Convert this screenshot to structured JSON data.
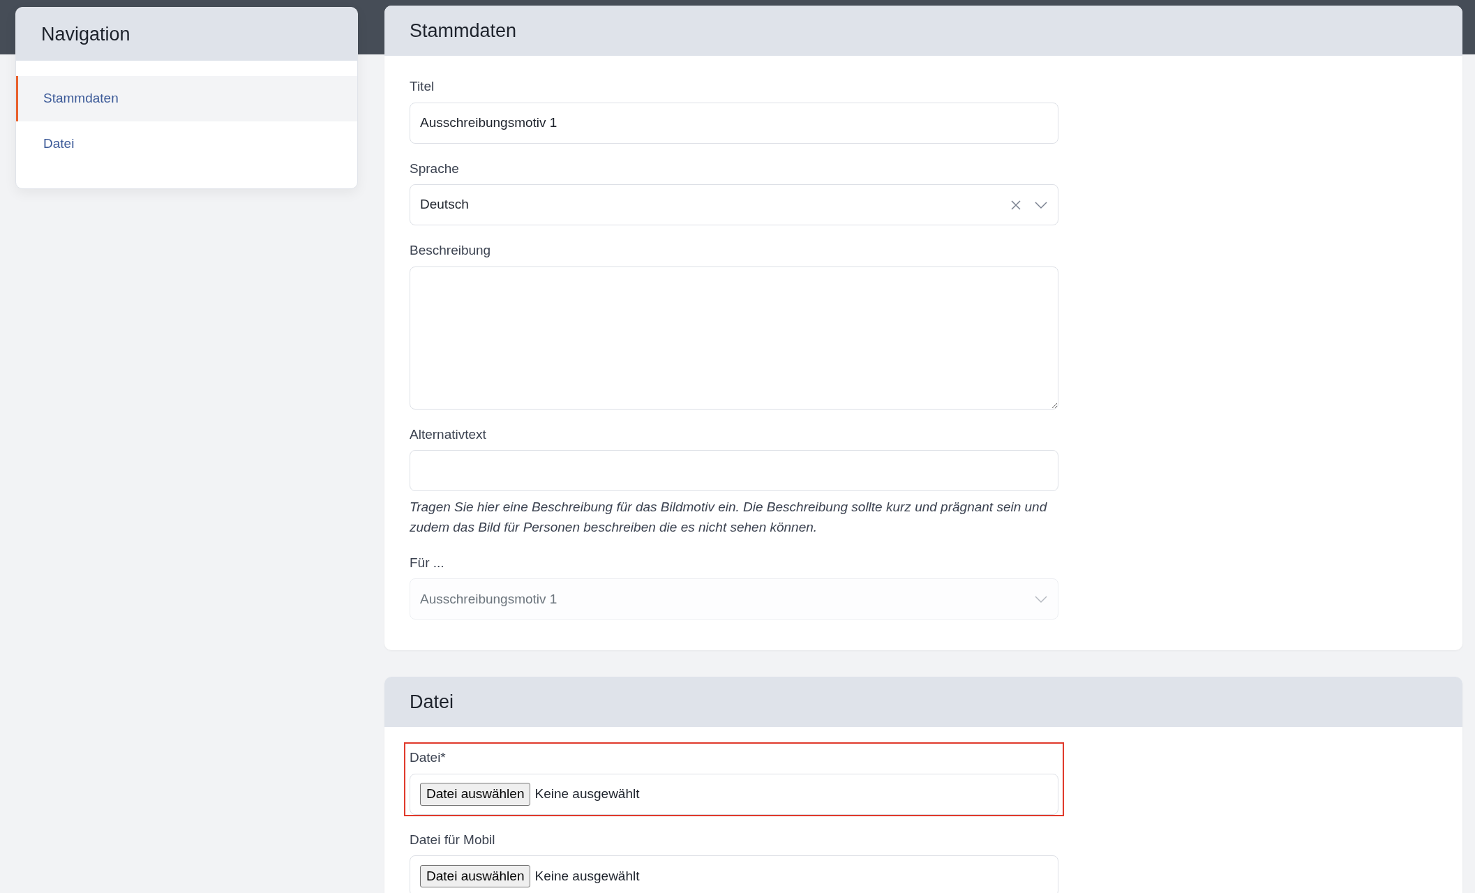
{
  "navigation": {
    "title": "Navigation",
    "items": [
      {
        "label": "Stammdaten",
        "selected": true
      },
      {
        "label": "Datei",
        "selected": false
      }
    ]
  },
  "sections": [
    {
      "title": "Stammdaten",
      "fields": [
        {
          "kind": "text",
          "label": "Titel",
          "value": "Ausschreibungsmotiv 1",
          "disabled": false,
          "highlighted": false
        },
        {
          "kind": "select",
          "label": "Sprache",
          "value": "Deutsch",
          "clearable": true,
          "disabled": false,
          "highlighted": false
        },
        {
          "kind": "textarea",
          "label": "Beschreibung",
          "disabled": false,
          "highlighted": false
        },
        {
          "kind": "text",
          "label": "Alternativtext",
          "help": "Tragen Sie hier eine Beschreibung für das Bildmotiv ein. Die Beschreibung sollte kurz und prägnant sein und zudem das Bild für Personen beschreiben die es nicht sehen können.",
          "disabled": false,
          "highlighted": false
        },
        {
          "kind": "select",
          "label": "Für ...",
          "placeholder": "Ausschreibungsmotiv 1",
          "clearable": false,
          "disabled": true,
          "highlighted": false
        }
      ]
    },
    {
      "title": "Datei",
      "fields": [
        {
          "kind": "file",
          "label": "Datei*",
          "button": "Datei auswählen",
          "status": "Keine ausgewählt",
          "disabled": false,
          "highlighted": true
        },
        {
          "kind": "file",
          "label": "Datei für Mobil",
          "button": "Datei auswählen",
          "status": "Keine ausgewählt",
          "disabled": false,
          "highlighted": false
        }
      ]
    }
  ]
}
